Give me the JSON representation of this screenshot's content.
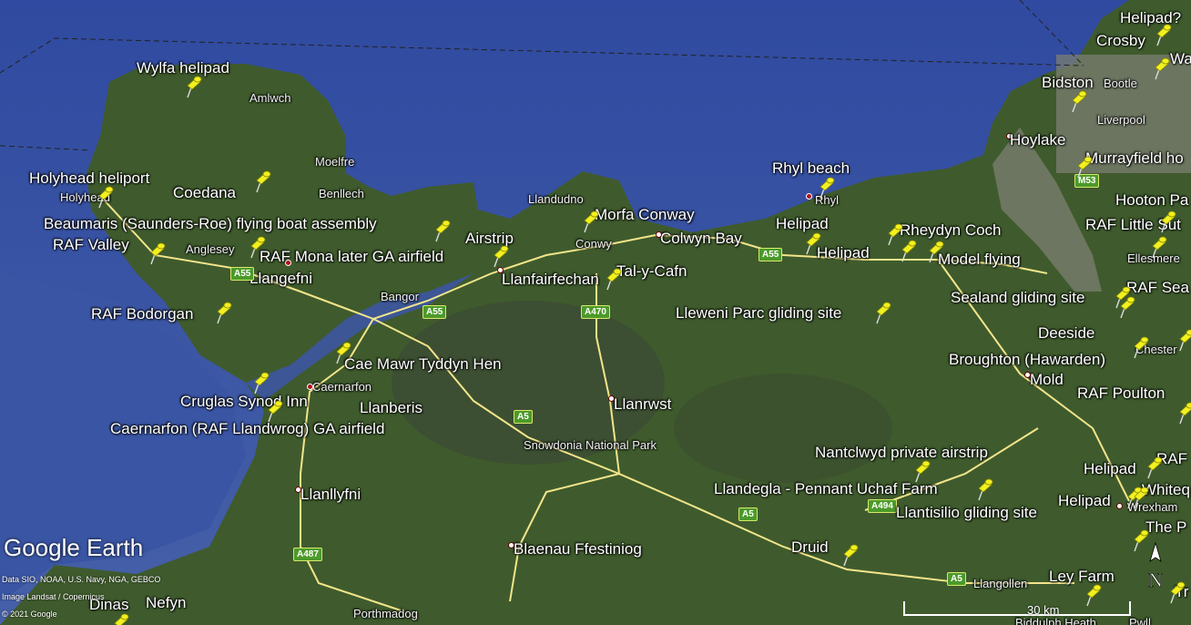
{
  "map": {
    "colors": {
      "sea": "#3b52a4",
      "land": "#3e5a2c",
      "urban": "#8a8a80",
      "road": "#f3e58a",
      "pin": "#f2f020"
    },
    "pins": [
      {
        "name": "pin-wylfa-helipad",
        "label": "Wylfa helipad"
      },
      {
        "name": "pin-holyhead-heliport",
        "label": "Holyhead heliport"
      },
      {
        "name": "pin-coedana",
        "label": "Coedana"
      },
      {
        "name": "pin-beaumaris",
        "label": "Beaumaris (Saunders-Roe) flying boat assembly"
      },
      {
        "name": "pin-raf-valley",
        "label": "RAF Valley"
      },
      {
        "name": "pin-raf-mona",
        "label": "RAF Mona later GA airfield"
      },
      {
        "name": "pin-airstrip",
        "label": "Airstrip"
      },
      {
        "name": "pin-raf-bodorgan",
        "label": "RAF Bodorgan"
      },
      {
        "name": "pin-morfa-conway",
        "label": "Morfa Conway"
      },
      {
        "name": "pin-tal-y-cafn",
        "label": "Tal-y-Cafn"
      },
      {
        "name": "pin-cae-mawr",
        "label": "Cae Mawr Tyddyn Hen"
      },
      {
        "name": "pin-cruglas",
        "label": "Cruglas Synod Inn"
      },
      {
        "name": "pin-caernarfon-airfield",
        "label": "Caernarfon (RAF Llandwrog) GA airfield"
      },
      {
        "name": "pin-rhyl-beach",
        "label": "Rhyl  beach"
      },
      {
        "name": "pin-helipad-1",
        "label": "Helipad"
      },
      {
        "name": "pin-helipad-2",
        "label": "Helipad"
      },
      {
        "name": "pin-rheydyn-coch",
        "label": "Rheydyn Coch"
      },
      {
        "name": "pin-model-flying",
        "label": "Model flying"
      },
      {
        "name": "pin-lleweni-parc",
        "label": "Lleweni Parc gliding site"
      },
      {
        "name": "pin-sealand",
        "label": "Sealand gliding site"
      },
      {
        "name": "pin-deeside",
        "label": "Deeside"
      },
      {
        "name": "pin-broughton",
        "label": "Broughton (Hawarden)"
      },
      {
        "name": "pin-raf-poulton",
        "label": "RAF Poulton"
      },
      {
        "name": "pin-nantclwyd",
        "label": "Nantclwyd private airstrip"
      },
      {
        "name": "pin-llandegla",
        "label": "Llandegla - Pennant Uchaf Farm"
      },
      {
        "name": "pin-llantisilio",
        "label": "Llantisilio gliding site"
      },
      {
        "name": "pin-druid",
        "label": "Druid"
      },
      {
        "name": "pin-ley-farm",
        "label": "Ley Farm"
      },
      {
        "name": "pin-helipad-3",
        "label": "Helipad"
      },
      {
        "name": "pin-helipad-4",
        "label": "Helipad"
      },
      {
        "name": "pin-helipad-top",
        "label": "Helipad?"
      },
      {
        "name": "pin-crosby",
        "label": "Crosby"
      },
      {
        "name": "pin-bidston",
        "label": "Bidston"
      },
      {
        "name": "pin-hoylake",
        "label": "Hoylake"
      },
      {
        "name": "pin-murrayfield",
        "label": "Murrayfield ho"
      },
      {
        "name": "pin-hooton",
        "label": "Hooton Pa"
      },
      {
        "name": "pin-raf-little-sutton",
        "label": "RAF Little Sut"
      },
      {
        "name": "pin-raf-sealand",
        "label": "RAF Sea"
      },
      {
        "name": "pin-raf-edge",
        "label": "RAF"
      },
      {
        "name": "pin-whitechurch",
        "label": "Whiteq"
      },
      {
        "name": "pin-the-p",
        "label": "The P"
      },
      {
        "name": "pin-dinas",
        "label": "Dinas"
      },
      {
        "name": "pin-nefyn",
        "label": "Nefyn"
      },
      {
        "name": "pin-tr",
        "label": "Tr"
      }
    ],
    "towns": [
      "Amlwch",
      "Moelfre",
      "Benllech",
      "Holyhead",
      "Anglesey",
      "Llangefni",
      "Bangor",
      "Caernarfon",
      "Llanberis",
      "Llandudno",
      "Conwy",
      "Colwyn Bay",
      "Llanfairfechan",
      "Rhyl",
      "Llanrwst",
      "Snowdonia National Park",
      "Llanllyfni",
      "Blaenau Ffestiniog",
      "Porthmadog",
      "Mold",
      "Chester",
      "Ellesmere",
      "Wrexham",
      "Llangollen",
      "Bootle",
      "Liverpool",
      "Wa",
      "Biddulph Heath",
      "Pwll"
    ],
    "roads": [
      "A55",
      "A55",
      "A55",
      "A470",
      "A5",
      "A487",
      "A494",
      "A5",
      "A5",
      "M53"
    ]
  },
  "branding": {
    "logo": "Google Earth",
    "credit_1": "Data SIO, NOAA, U.S. Navy, NGA, GEBCO",
    "credit_2": "Image Landsat / Copernicus",
    "credit_3": "© 2021 Google",
    "scale": "30 km",
    "north_label": "N"
  }
}
